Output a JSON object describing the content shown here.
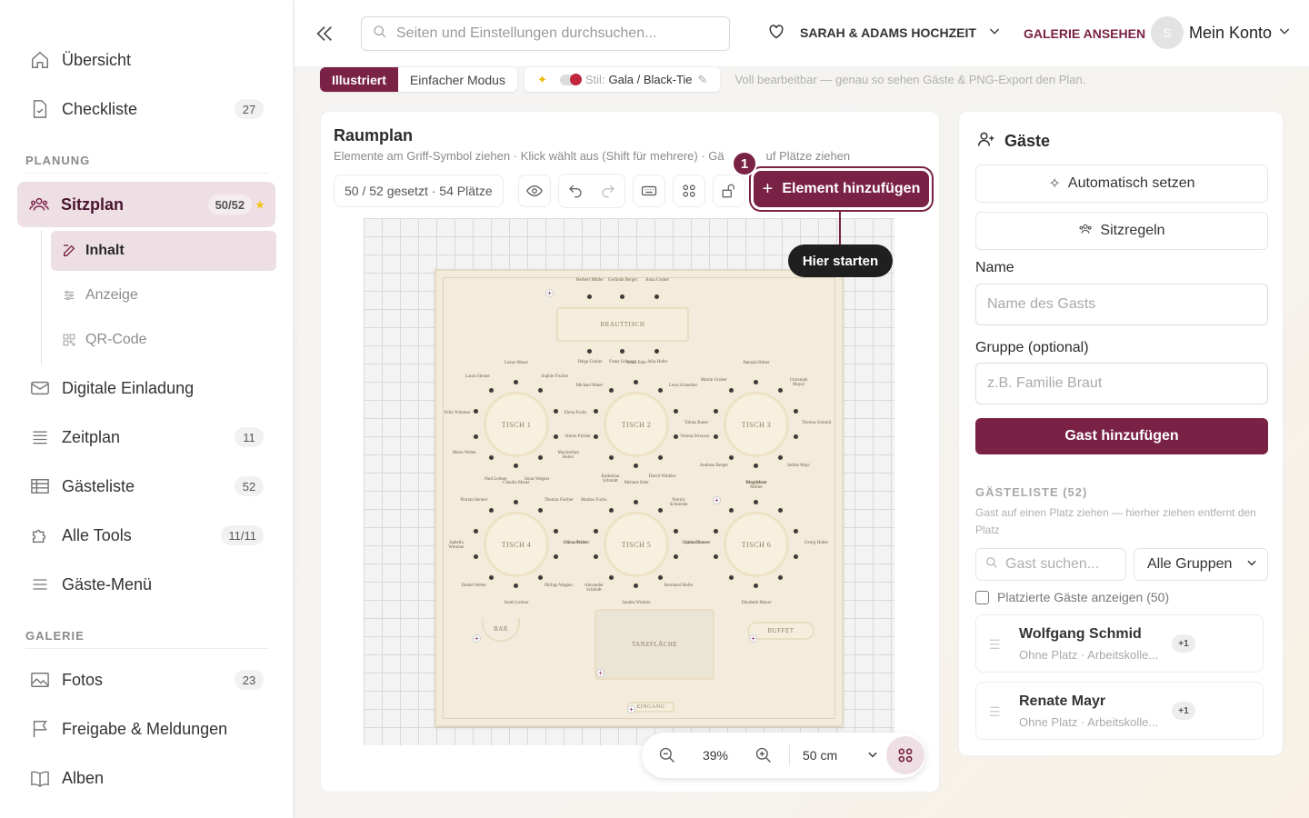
{
  "sidebar": {
    "items": [
      {
        "label": "Übersicht",
        "icon": "home-icon"
      },
      {
        "label": "Checkliste",
        "badge": "27",
        "icon": "checklist-icon"
      },
      {
        "label": "Sitzplan",
        "badge": "50/52",
        "icon": "users-icon",
        "star": "★"
      },
      {
        "label": "Digitale Einladung",
        "icon": "mail-icon"
      },
      {
        "label": "Zeitplan",
        "badge": "11",
        "icon": "list-icon"
      },
      {
        "label": "Gästeliste",
        "badge": "52",
        "icon": "table-icon"
      },
      {
        "label": "Alle Tools",
        "badge": "11/11",
        "icon": "puzzle-icon"
      },
      {
        "label": "Gäste-Menü",
        "icon": "menu-icon"
      },
      {
        "label": "Fotos",
        "badge": "23",
        "icon": "image-icon"
      },
      {
        "label": "Freigabe & Meldungen",
        "icon": "flag-icon"
      },
      {
        "label": "Alben",
        "icon": "book-icon"
      }
    ],
    "sections": {
      "planung": "PLANUNG",
      "galerie": "GALERIE"
    },
    "sub_items": [
      {
        "label": "Inhalt",
        "icon": "edit-icon"
      },
      {
        "label": "Anzeige",
        "icon": "sliders-icon"
      },
      {
        "label": "QR-Code",
        "icon": "qr-icon"
      }
    ]
  },
  "header": {
    "search_placeholder": "Seiten und Einstellungen durchsuchen...",
    "wedding": "SARAH & ADAMS HOCHZEIT",
    "gallery_link": "GALERIE ANSEHEN",
    "avatar_letter": "S",
    "account": "Mein Konto"
  },
  "modebar": {
    "illustrated": "Illustriert",
    "simple": "Einfacher Modus",
    "style_prefix": "Stil:",
    "style_value": "Gala / Black-Tie",
    "hint": "Voll bearbeitbar — genau so sehen Gäste & PNG-Export den Plan."
  },
  "planner": {
    "title": "Raumplan",
    "subtitle": "Elemente am Griff-Symbol ziehen · Klick wählt aus (Shift für mehrere) · Gä",
    "subtitle_tail": "uf Plätze ziehen",
    "count": "50 / 52 gesetzt · 54 Plätze",
    "add_button": "Element hinzufügen",
    "step": "1",
    "tooltip": "Hier starten",
    "zoom": "39%",
    "grid": "50 cm"
  },
  "floorplan": {
    "head_table": "BRAUTTISCH",
    "tables": [
      "TISCH 1",
      "TISCH 2",
      "TISCH 3",
      "TISCH 4",
      "TISCH 5",
      "TISCH 6"
    ],
    "bar": "BAR",
    "buffet": "BUFFET",
    "dancefloor": "TANZFLÄCHE",
    "entrance": "EINGANG",
    "head_guests_top": [
      "Herbert Müller",
      "Gerlinde Berger",
      "Anna Gruber"
    ],
    "head_guests_bottom": [
      "Helga Gruber",
      "Franz Schwarz",
      "Julia Hofer"
    ],
    "table_guests": [
      [
        "Lukas Moser",
        "Sophie Fischer",
        "Elena Fuchs",
        "Maximilian Reiter",
        "Jonas Wagner",
        "Paul Leitner",
        "Marie Weber",
        "Felix Wimmer",
        "Laura Steiner"
      ],
      [
        "Jonas Eder",
        "Lena Schneider",
        "Verena Schwarz",
        "David Winkler",
        "Katharina Schmidt",
        "Simon Pichler",
        "Michael Maier"
      ],
      [
        "Hannah Huber",
        "Christoph Mayer",
        "Theresa Schmid",
        "Stefan Mayr",
        "Magdalena Müller",
        "Andreas Berger",
        "Tobias Bauer",
        "Martin Gruber"
      ],
      [
        "Claudia Moser",
        "Thomas Fischer",
        "Nina Reiter",
        "Philipp Wagner",
        "Sarah Leitner",
        "Daniel Weber",
        "Isabella Wimmer",
        "Florian Steiner"
      ],
      [
        "Melanie Eder",
        "Patrick Schneider",
        "Carina Bauer",
        "Bernhard Hofer",
        "Sandra Winkler",
        "Alexander Schmidt",
        "Bianca Pichler",
        "Markus Fuchs"
      ],
      [
        "Petra Maier",
        "Georg Huber",
        "Elisabeth Mayer",
        "Sophie Brunner"
      ]
    ]
  },
  "guests": {
    "title": "Gäste",
    "auto_button": "Automatisch setzen",
    "rules_button": "Sitzregeln",
    "name_label": "Name",
    "name_placeholder": "Name des Gasts",
    "group_label": "Gruppe (optional)",
    "group_placeholder": "z.B. Familie Braut",
    "add_button": "Gast hinzufügen",
    "list_header": "GÄSTELISTE (52)",
    "list_hint": "Gast auf einen Platz ziehen — hierher ziehen entfernt den Platz",
    "search_placeholder": "Gast suchen...",
    "group_select": "Alle Gruppen",
    "show_placed": "Platzierte Gäste anzeigen (50)",
    "cards": [
      {
        "name": "Wolfgang Schmid",
        "meta": "Ohne Platz · Arbeitskolle...",
        "plus": "+1"
      },
      {
        "name": "Renate Mayr",
        "meta": "Ohne Platz · Arbeitskolle...",
        "plus": "+1"
      }
    ]
  },
  "colors": {
    "accent": "#7a2245",
    "active_bg": "#eddfe3"
  }
}
